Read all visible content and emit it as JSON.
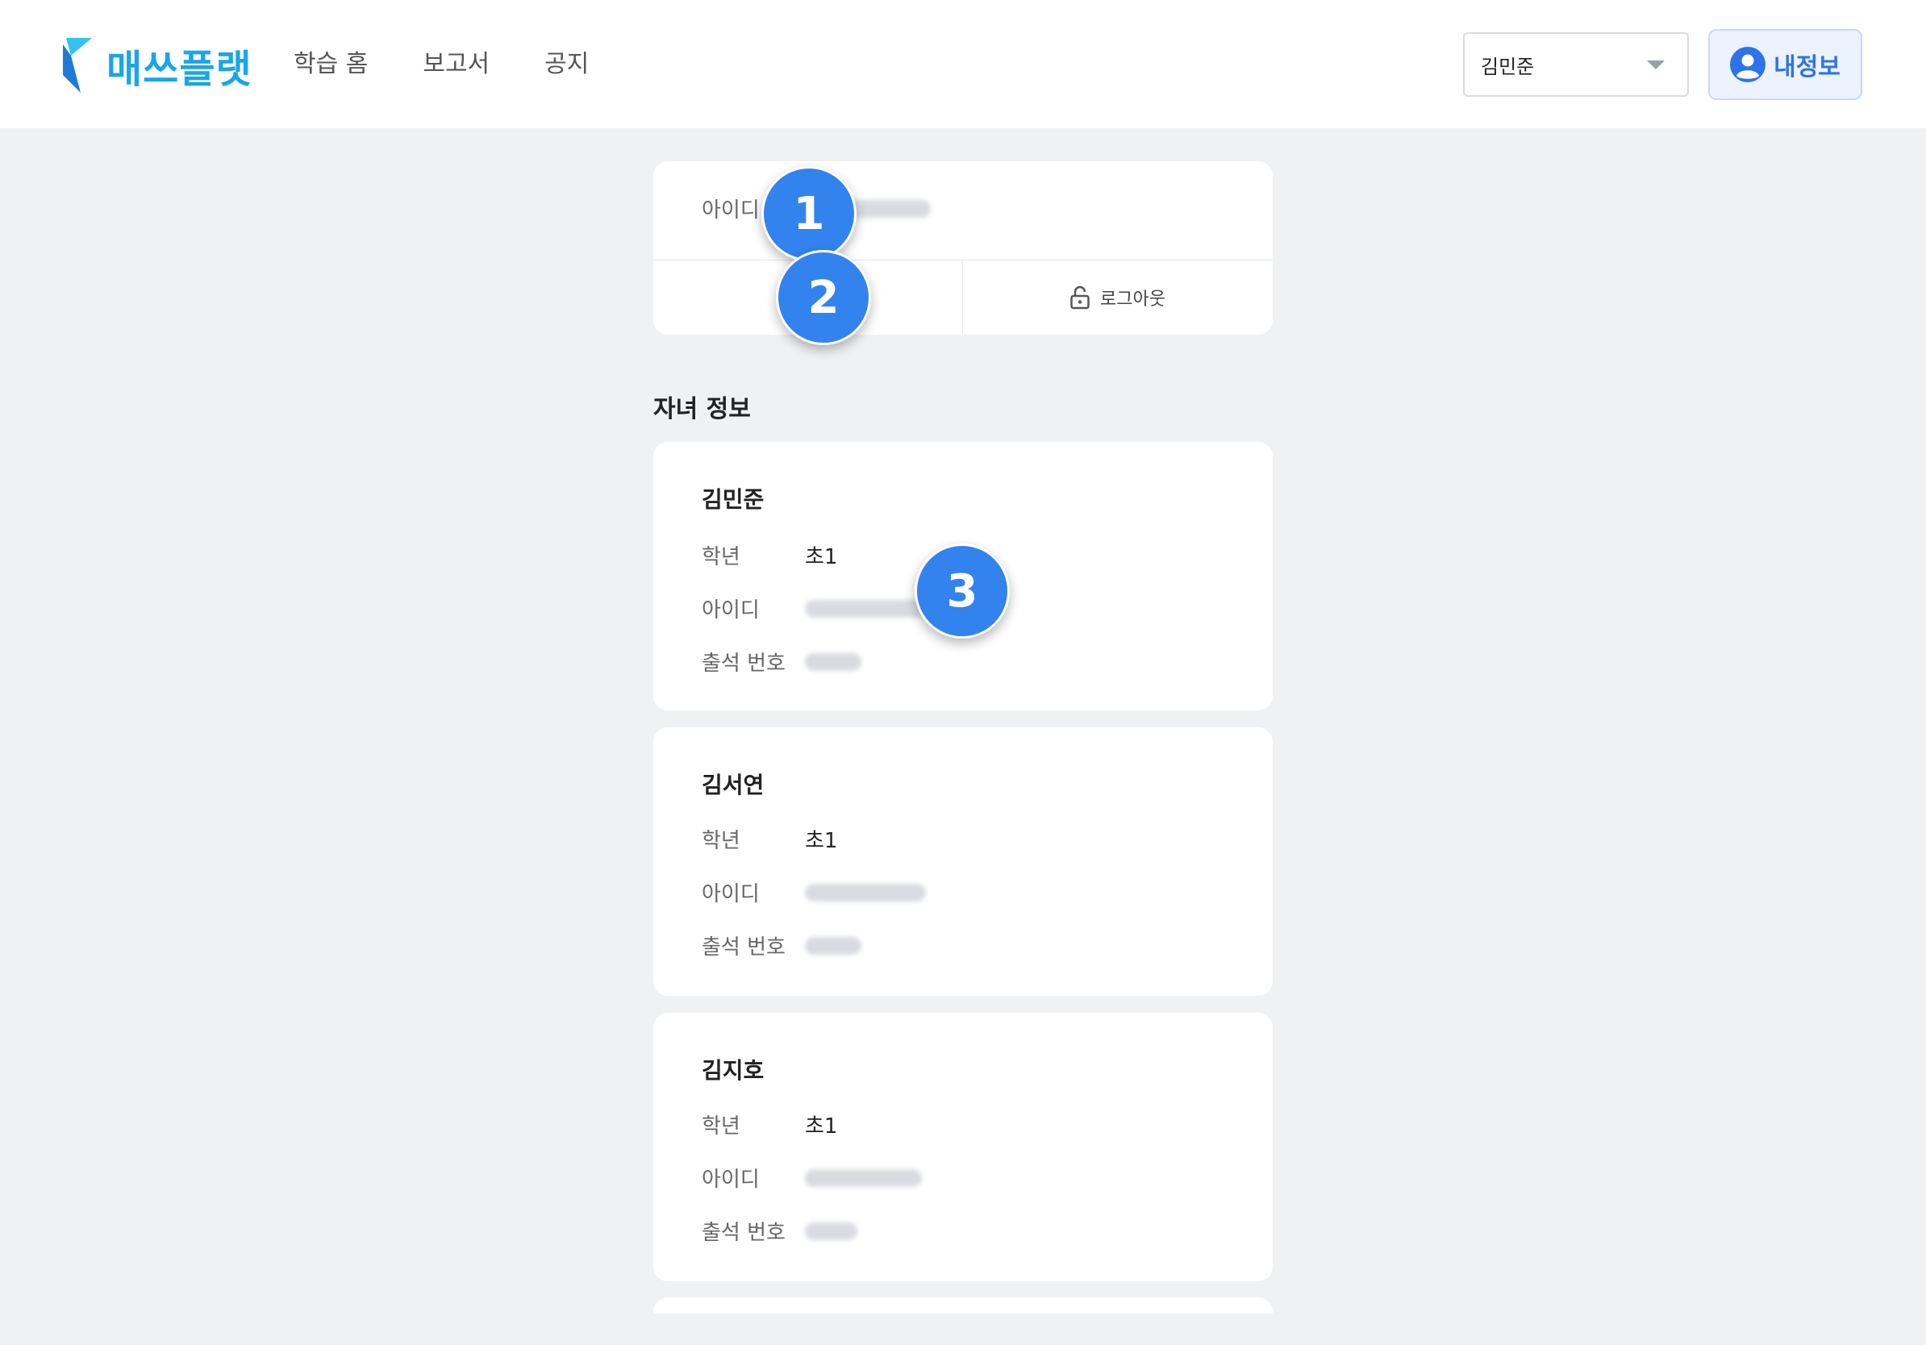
{
  "header": {
    "logo_text": "매쓰플랫",
    "nav": [
      "학습 홈",
      "보고서",
      "공지"
    ],
    "child_select": {
      "value": "김민준"
    },
    "myinfo_label": "내정보"
  },
  "account": {
    "id_label": "아이디",
    "edit_label": "",
    "logout_label": "로그아웃"
  },
  "section_title": "자녀 정보",
  "children": [
    {
      "name": "김민준",
      "grade_label": "학년",
      "grade": "초1",
      "id_label": "아이디",
      "attendance_label": "출석 번호"
    },
    {
      "name": "김서연",
      "grade_label": "학년",
      "grade": "초1",
      "id_label": "아이디",
      "attendance_label": "출석 번호"
    },
    {
      "name": "김지호",
      "grade_label": "학년",
      "grade": "초1",
      "id_label": "아이디",
      "attendance_label": "출석 번호"
    }
  ],
  "markers": [
    "1",
    "2",
    "3"
  ],
  "colors": {
    "brand": "#1aa6e8",
    "accent": "#2f73e8",
    "marker": "#3283ee",
    "background": "#f0f1f3"
  },
  "icons": {
    "edit": "pencil-icon",
    "logout": "lock-open-icon",
    "myinfo": "user-circle-icon",
    "select": "caret-down-icon"
  }
}
